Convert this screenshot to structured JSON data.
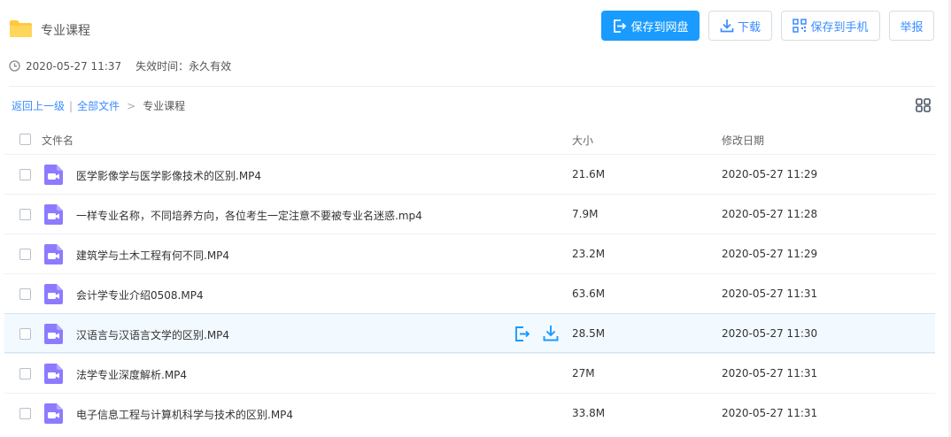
{
  "header": {
    "folder_title": "专业课程",
    "buttons": {
      "save_to_cloud": "保存到网盘",
      "download": "下载",
      "save_to_phone": "保存到手机",
      "report": "举报"
    },
    "share_time": "2020-05-27 11:37",
    "expire_label": "失效时间：",
    "expire_value": "永久有效"
  },
  "breadcrumb": {
    "back": "返回上一级",
    "separator": "|",
    "all_files": "全部文件",
    "arrow": ">",
    "current": "专业课程"
  },
  "table": {
    "columns": {
      "name": "文件名",
      "size": "大小",
      "date": "修改日期"
    },
    "rows": [
      {
        "name": "医学影像学与医学影像技术的区别.MP4",
        "size": "21.6M",
        "date": "2020-05-27 11:29"
      },
      {
        "name": "一样专业名称，不同培养方向，各位考生一定注意不要被专业名迷惑.mp4",
        "size": "7.9M",
        "date": "2020-05-27 11:28"
      },
      {
        "name": "建筑学与土木工程有何不同.MP4",
        "size": "23.2M",
        "date": "2020-05-27 11:29"
      },
      {
        "name": "会计学专业介绍0508.MP4",
        "size": "63.6M",
        "date": "2020-05-27 11:31"
      },
      {
        "name": "汉语言与汉语言文学的区别.MP4",
        "size": "28.5M",
        "date": "2020-05-27 11:30",
        "hovered": true
      },
      {
        "name": "法学专业深度解析.MP4",
        "size": "27M",
        "date": "2020-05-27 11:31"
      },
      {
        "name": "电子信息工程与计算机科学与技术的区别.MP4",
        "size": "33.8M",
        "date": "2020-05-27 11:31"
      }
    ]
  },
  "colors": {
    "accent": "#1a9bff",
    "link": "#3b8cff",
    "folder": "#ffc93c",
    "video_icon": "#8c7bff",
    "hover_row": "#f2f9ff"
  },
  "icons": {
    "folder": "folder-icon",
    "clock": "clock-icon",
    "save": "save-to-cloud-icon",
    "download": "download-icon",
    "qr": "qr-phone-icon",
    "grid": "grid-view-icon",
    "video": "video-file-icon"
  }
}
